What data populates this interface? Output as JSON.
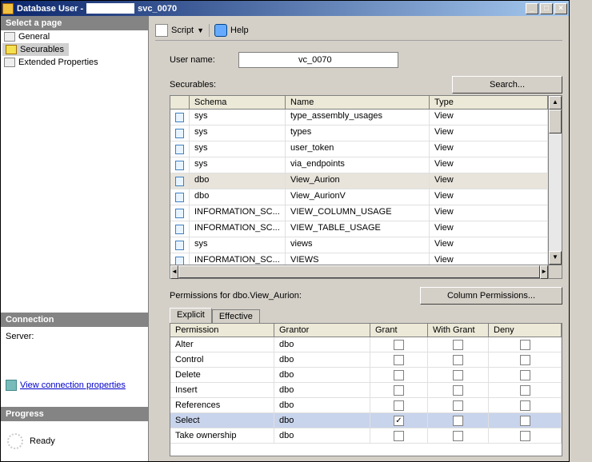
{
  "title_prefix": "Database User - ",
  "title_suffix": "svc_0070",
  "win": {
    "min": "_",
    "max": "□",
    "close": "×"
  },
  "sidebar": {
    "select_page": "Select a page",
    "pages": [
      {
        "label": "General"
      },
      {
        "label": "Securables"
      },
      {
        "label": "Extended Properties"
      }
    ],
    "connection_hdr": "Connection",
    "server_label": "Server:",
    "link_text": "View connection properties",
    "progress_hdr": "Progress",
    "ready": "Ready"
  },
  "toolbar": {
    "script": "Script",
    "drop": "▼",
    "help": "Help"
  },
  "username_label": "User name:",
  "username_value": "vc_0070",
  "securables_label": "Securables:",
  "search_btn": "Search...",
  "grid": {
    "headers": {
      "schema": "Schema",
      "name": "Name",
      "type": "Type"
    },
    "rows": [
      {
        "schema": "sys",
        "name": "type_assembly_usages",
        "type": "View"
      },
      {
        "schema": "sys",
        "name": "types",
        "type": "View"
      },
      {
        "schema": "sys",
        "name": "user_token",
        "type": "View"
      },
      {
        "schema": "sys",
        "name": "via_endpoints",
        "type": "View"
      },
      {
        "schema": "dbo",
        "name": "View_Aurion",
        "type": "View"
      },
      {
        "schema": "dbo",
        "name": "View_AurionV",
        "type": "View"
      },
      {
        "schema": "INFORMATION_SC...",
        "name": "VIEW_COLUMN_USAGE",
        "type": "View"
      },
      {
        "schema": "INFORMATION_SC...",
        "name": "VIEW_TABLE_USAGE",
        "type": "View"
      },
      {
        "schema": "sys",
        "name": "views",
        "type": "View"
      },
      {
        "schema": "INFORMATION_SC...",
        "name": "VIEWS",
        "type": "View"
      }
    ],
    "selected_index": 4
  },
  "perm_label": "Permissions for dbo.View_Aurion:",
  "col_perm_btn": "Column Permissions...",
  "tabs": {
    "explicit": "Explicit",
    "effective": "Effective"
  },
  "perm": {
    "headers": {
      "perm": "Permission",
      "grantor": "Grantor",
      "grant": "Grant",
      "with": "With Grant",
      "deny": "Deny"
    },
    "rows": [
      {
        "perm": "Alter",
        "grantor": "dbo",
        "grant": false,
        "with": false,
        "deny": false
      },
      {
        "perm": "Control",
        "grantor": "dbo",
        "grant": false,
        "with": false,
        "deny": false
      },
      {
        "perm": "Delete",
        "grantor": "dbo",
        "grant": false,
        "with": false,
        "deny": false
      },
      {
        "perm": "Insert",
        "grantor": "dbo",
        "grant": false,
        "with": false,
        "deny": false
      },
      {
        "perm": "References",
        "grantor": "dbo",
        "grant": false,
        "with": false,
        "deny": false
      },
      {
        "perm": "Select",
        "grantor": "dbo",
        "grant": true,
        "with": false,
        "deny": false
      },
      {
        "perm": "Take ownership",
        "grantor": "dbo",
        "grant": false,
        "with": false,
        "deny": false
      }
    ],
    "selected_index": 5
  },
  "scroll": {
    "up": "▲",
    "down": "▼",
    "left": "◄",
    "right": "►"
  }
}
